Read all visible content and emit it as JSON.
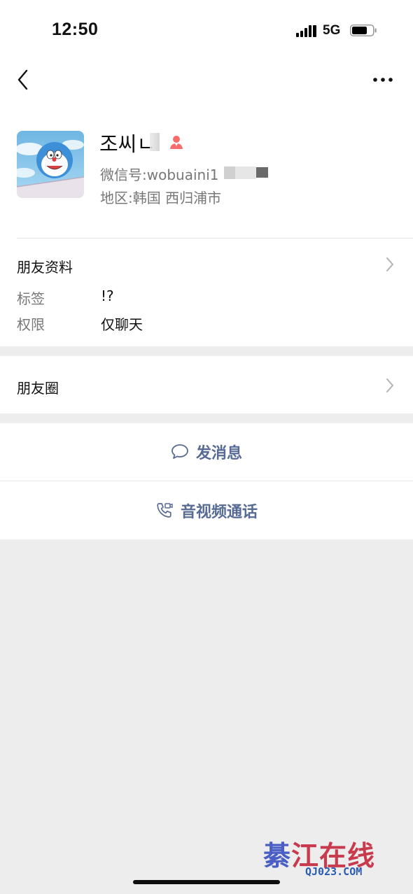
{
  "status_bar": {
    "time": "12:50",
    "network": "5G"
  },
  "nav": {
    "back_icon": "chevron-left-icon",
    "more_icon": "ellipsis-icon"
  },
  "profile": {
    "name": "조씨ㄴ",
    "gender_icon": "female-icon",
    "gender_color": "#fa5151",
    "wechat_id_label": "微信号:",
    "wechat_id_value": "wobuaini1",
    "region_label": "地区:",
    "region_value": "韩国 西归浦市"
  },
  "friend_profile": {
    "title": "朋友资料",
    "rows": [
      {
        "label": "标签",
        "value": "!?"
      },
      {
        "label": "权限",
        "value": "仅聊天"
      }
    ]
  },
  "moments": {
    "title": "朋友圈"
  },
  "actions": {
    "message_label": "发消息",
    "message_icon": "chat-bubble-icon",
    "call_label": "音视频通话",
    "call_icon": "phone-video-icon",
    "accent_color": "#576b95"
  },
  "watermark": {
    "first_char": "綦",
    "rest": "江在线",
    "url": "QJ023.COM"
  }
}
